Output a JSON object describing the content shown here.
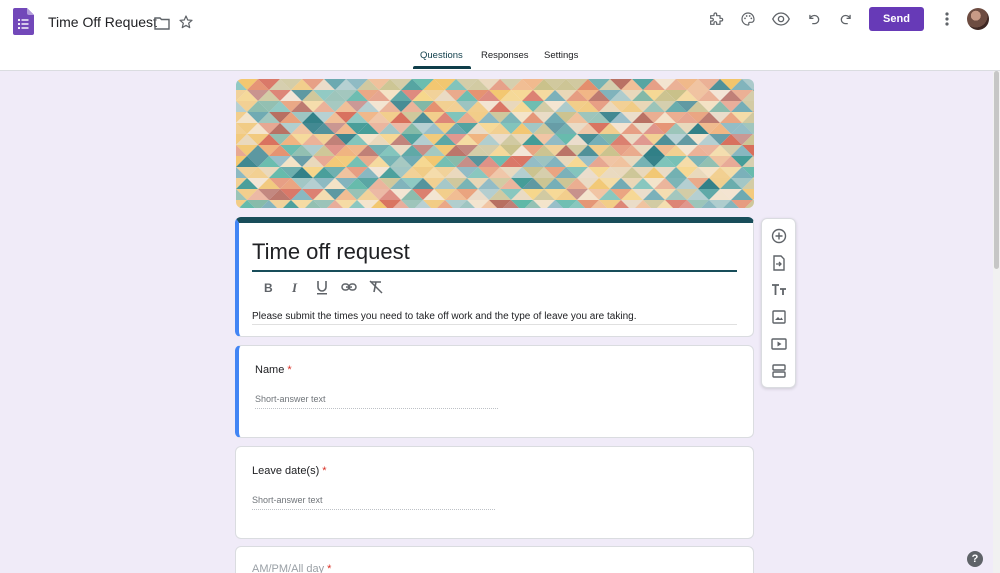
{
  "app": {
    "doc_title": "Time Off Request",
    "send_label": "Send"
  },
  "tabs": [
    {
      "label": "Questions",
      "active": true
    },
    {
      "label": "Responses",
      "active": false
    },
    {
      "label": "Settings",
      "active": false
    }
  ],
  "form": {
    "title": "Time off request",
    "description": "Please submit the times you need to take off work and the type of leave you are taking."
  },
  "questions": [
    {
      "label": "Name",
      "required_mark": "*",
      "placeholder": "Short-answer text"
    },
    {
      "label": "Leave date(s)",
      "required_mark": "*",
      "placeholder": "Short-answer text"
    },
    {
      "label": "AM/PM/All day",
      "required_mark": "*"
    }
  ],
  "help_label": "?",
  "colors": {
    "accent": "#673ab7",
    "theme": "#184d5a",
    "active_question": "#4285f4",
    "background": "#f0ebf8",
    "required": "#d93025"
  },
  "icons": {
    "topbar": [
      "forms-logo-icon",
      "folder-icon",
      "star-icon",
      "addon-puzzle-icon",
      "palette-icon",
      "preview-eye-icon",
      "undo-icon",
      "redo-icon",
      "more-vert-icon"
    ],
    "format": [
      "bold-icon",
      "italic-icon",
      "underline-icon",
      "link-icon",
      "clear-format-icon"
    ],
    "side_toolbar": [
      "add-question-icon",
      "import-questions-icon",
      "add-title-icon",
      "add-image-icon",
      "add-video-icon",
      "add-section-icon"
    ]
  }
}
